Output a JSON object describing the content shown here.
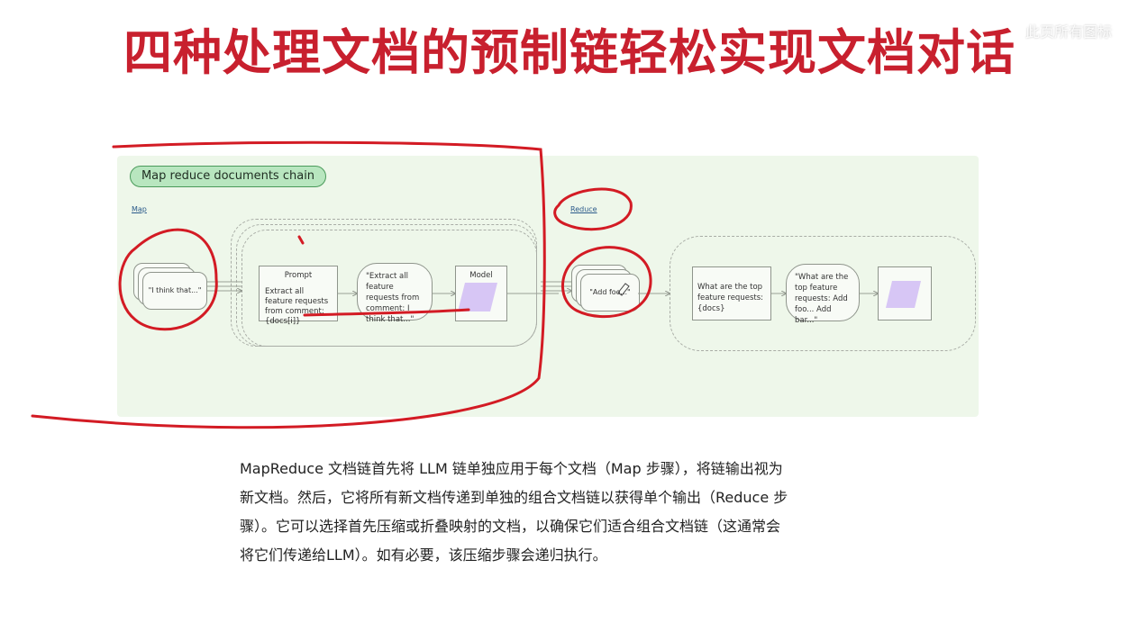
{
  "title": "四种处理文档的预制链轻松实现文档对话",
  "watermark": "此页所有图标",
  "diagram": {
    "chain_label": "Map reduce documents chain",
    "map_label": "Map",
    "reduce_label": "Reduce",
    "map_doc_text": "\"I think that...\"",
    "prompt_title": "Prompt",
    "prompt_body": "Extract all feature requests from comment: {docs[i]}",
    "map_bubble": "\"Extract all feature requests from comment: I think that...\"",
    "model_title": "Model",
    "reduce_doc_text": "\"Add foo...\"",
    "reduce_prompt_body": "What are the top feature requests: {docs}",
    "reduce_bubble": "\"What are the top feature requests: Add foo... Add bar...\"",
    "colors": {
      "panel_bg": "#eef7ea",
      "badge_bg": "#b8e6bf",
      "model_fill": "#d7c6f5",
      "annotation": "#d31b24"
    }
  },
  "paragraph": {
    "line1": "MapReduce 文档链首先将 LLM 链单独应用于每个文档（Map 步骤），将链输出视为",
    "line2": "新文档。然后，它将所有新文档传递到单独的组合文档链以获得单个输出（Reduce 步",
    "line3": "骤）。它可以选择首先压缩或折叠映射的文档，以确保它们适合组合文档链（这通常会",
    "line4": "将它们传递给LLM）。如有必要，该压缩步骤会递归执行。"
  }
}
